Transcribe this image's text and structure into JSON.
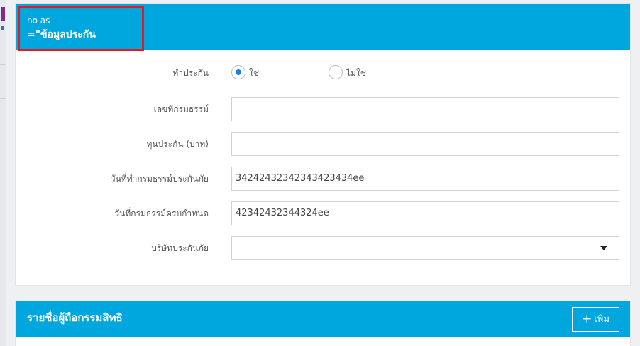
{
  "insurance_panel": {
    "header_line1": "no as",
    "header_line2": "=\"ข้อมูลประกัน"
  },
  "form": {
    "insured": {
      "label": "ทำประกัน",
      "options": [
        {
          "label": "ใช่",
          "selected": true
        },
        {
          "label": "ไม่ใช่",
          "selected": false
        }
      ]
    },
    "policy_number": {
      "label": "เลขที่กรมธรรม์",
      "value": ""
    },
    "sum_insured": {
      "label": "ทุนประกัน (บาท)",
      "value": ""
    },
    "policy_start_date": {
      "label": "วันที่ทำกรมธรรม์ประกันภัย",
      "value": "34242432342343423434ee"
    },
    "policy_end_date": {
      "label": "วันที่กรมธรรม์ครบกำหนด",
      "value": "42342432344324ee"
    },
    "insurance_company": {
      "label": "บริษัทประกันภัย",
      "value": ""
    }
  },
  "owners_panel": {
    "title": "รายชื่อผู้ถือกรรมสิทธิ",
    "add_button": "เพิ่ม",
    "add_icon": "plus-icon"
  },
  "colors": {
    "header_blue": "#00a6de",
    "highlight_red": "#e11b22",
    "radio_blue": "#1e7fe0"
  }
}
